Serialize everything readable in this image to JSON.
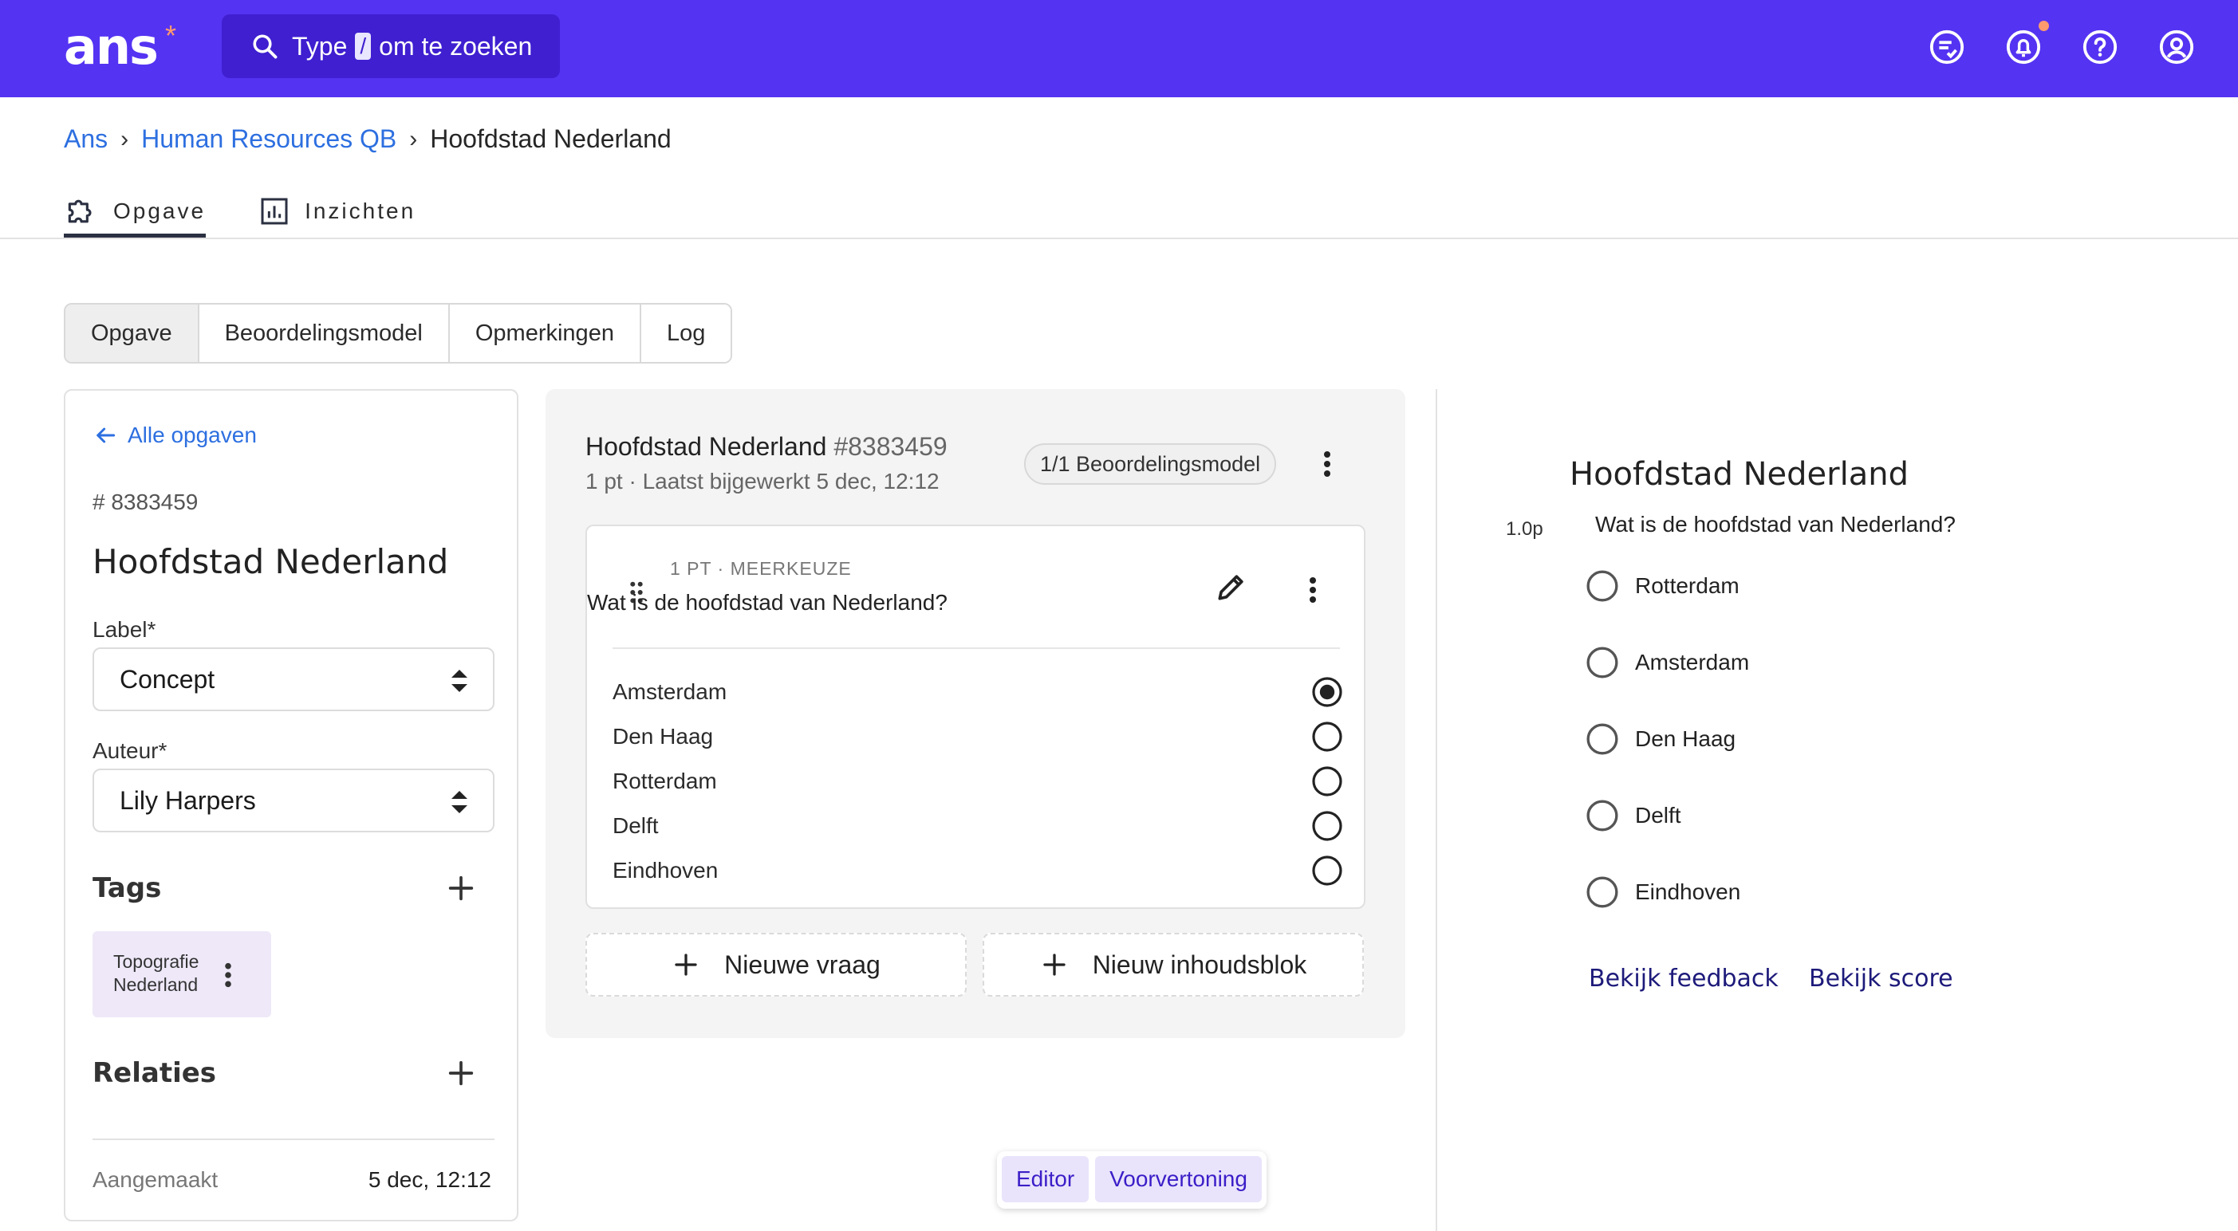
{
  "app": {
    "logo_text": "ans",
    "logo_mark": "*",
    "search": {
      "prefix": "Type",
      "key": "/",
      "suffix": "om te zoeken"
    },
    "top_icons": [
      "task-list-icon",
      "bell-icon",
      "help-icon",
      "user-icon"
    ],
    "accent_color": "#5533f2"
  },
  "breadcrumb": [
    "Ans",
    "Human Resources QB",
    "Hoofdstad Nederland"
  ],
  "main_tabs": [
    {
      "label": "Opgave",
      "icon": "puzzle-icon",
      "active": true
    },
    {
      "label": "Inzichten",
      "icon": "chart-icon",
      "active": false
    }
  ],
  "sub_tabs": [
    {
      "label": "Opgave",
      "active": true
    },
    {
      "label": "Beoordelingsmodel",
      "active": false
    },
    {
      "label": "Opmerkingen",
      "active": false
    },
    {
      "label": "Log",
      "active": false
    }
  ],
  "sidebar": {
    "back_label": "Alle opgaven",
    "id_label": "# 8383459",
    "title": "Hoofdstad Nederland",
    "label_field": {
      "label": "Label*",
      "value": "Concept"
    },
    "author_field": {
      "label": "Auteur*",
      "value": "Lily Harpers"
    },
    "tags_title": "Tags",
    "tag": {
      "line1": "Topografie",
      "line2": "Nederland"
    },
    "relations_title": "Relaties",
    "created_label": "Aangemaakt",
    "created_value": "5 dec, 12:12"
  },
  "editor": {
    "title": "Hoofdstad Nederland",
    "id": "#8383459",
    "subtitle": "1 pt · Laatst bijgewerkt 5 dec, 12:12",
    "rubric_pill": "1/1 Beoordelingsmodel",
    "question": {
      "meta": "1 PT · MEERKEUZE",
      "text": "Wat is de hoofdstad van Nederland?",
      "options": [
        {
          "label": "Amsterdam",
          "selected": true
        },
        {
          "label": "Den Haag",
          "selected": false
        },
        {
          "label": "Rotterdam",
          "selected": false
        },
        {
          "label": "Delft",
          "selected": false
        },
        {
          "label": "Eindhoven",
          "selected": false
        }
      ]
    },
    "add_question": "Nieuwe vraag",
    "add_block": "Nieuw inhoudsblok"
  },
  "view_toggle": {
    "editor": "Editor",
    "preview": "Voorvertoning"
  },
  "preview": {
    "title": "Hoofdstad Nederland",
    "points": "1.0p",
    "question": "Wat is de hoofdstad van Nederland?",
    "options": [
      "Rotterdam",
      "Amsterdam",
      "Den Haag",
      "Delft",
      "Eindhoven"
    ],
    "feedback_link": "Bekijk feedback",
    "score_link": "Bekijk score"
  }
}
